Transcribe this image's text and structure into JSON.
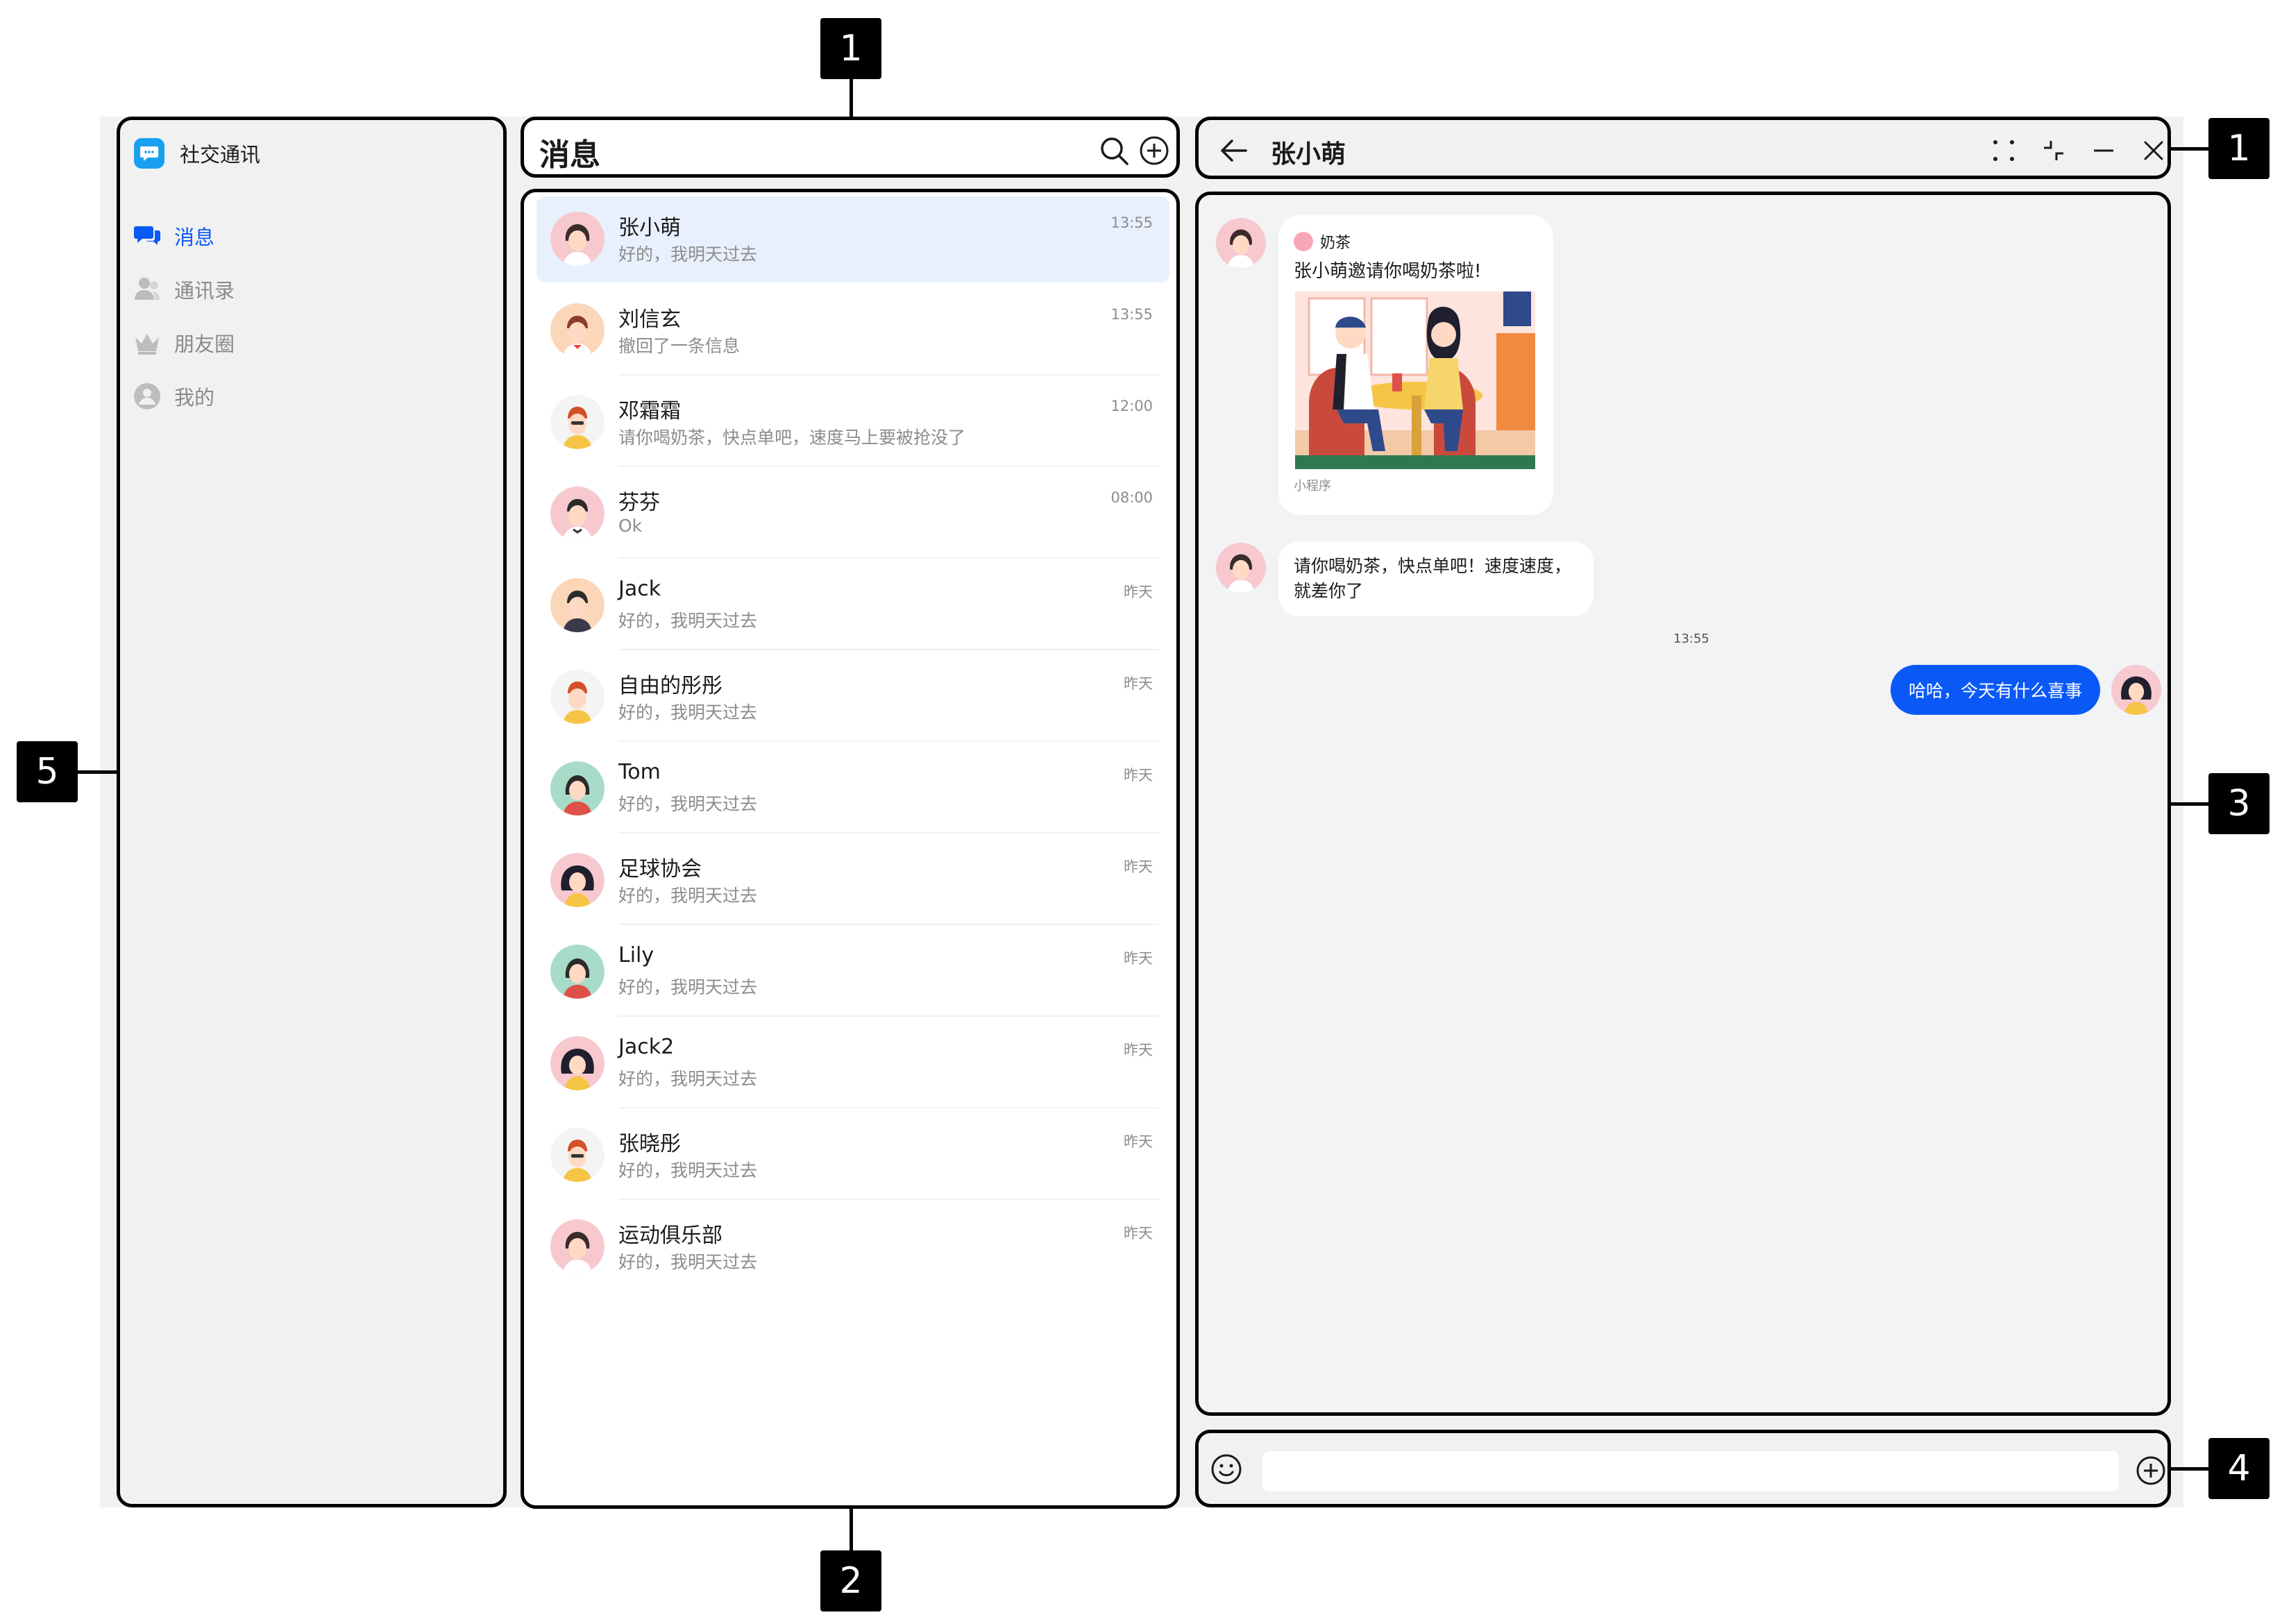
{
  "sidebar": {
    "app_title": "社交通讯",
    "items": [
      {
        "label": "消息",
        "icon": "chat-bubble-icon",
        "active": true
      },
      {
        "label": "通讯录",
        "icon": "contacts-icon",
        "active": false
      },
      {
        "label": "朋友圈",
        "icon": "moments-crown-icon",
        "active": false
      },
      {
        "label": "我的",
        "icon": "profile-icon",
        "active": false
      }
    ]
  },
  "list_header": {
    "title": "消息"
  },
  "conversations": [
    {
      "name": "张小萌",
      "preview": "好的，我明天过去",
      "time": "13:55",
      "selected": true
    },
    {
      "name": "刘信玄",
      "preview": "撤回了一条信息",
      "time": "13:55"
    },
    {
      "name": "邓霜霜",
      "preview": "请你喝奶茶，快点单吧，速度马上要被抢没了",
      "time": "12:00"
    },
    {
      "name": "芬芬",
      "preview": "Ok",
      "time": "08:00"
    },
    {
      "name": "Jack",
      "preview": "好的，我明天过去",
      "time": "昨天"
    },
    {
      "name": "自由的彤彤",
      "preview": "好的，我明天过去",
      "time": "昨天"
    },
    {
      "name": "Tom",
      "preview": "好的，我明天过去",
      "time": "昨天"
    },
    {
      "name": "足球协会",
      "preview": "好的，我明天过去",
      "time": "昨天"
    },
    {
      "name": "Lily",
      "preview": "好的，我明天过去",
      "time": "昨天"
    },
    {
      "name": "Jack2",
      "preview": "好的，我明天过去",
      "time": "昨天"
    },
    {
      "name": "张晓彤",
      "preview": "好的，我明天过去",
      "time": "昨天"
    },
    {
      "name": "运动俱乐部",
      "preview": "好的，我明天过去",
      "time": "昨天"
    }
  ],
  "chat": {
    "title": "张小萌",
    "mini_program": {
      "app_name": "奶茶",
      "description": "张小萌邀请你喝奶茶啦!",
      "footer": "小程序"
    },
    "incoming_text_line1": "请你喝奶茶，快点单吧！速度速度，",
    "incoming_text_line2": "就差你了",
    "timestamp": "13:55",
    "outgoing_text": "哈哈，今天有什么喜事"
  },
  "callouts": {
    "m1": "1",
    "m1b": "1",
    "m2": "2",
    "m3": "3",
    "m4": "4",
    "m5": "5"
  },
  "colors": {
    "accent": "#0a59f7",
    "selected_row": "#e9f0fd",
    "app_logo": "#1aa0f0"
  }
}
